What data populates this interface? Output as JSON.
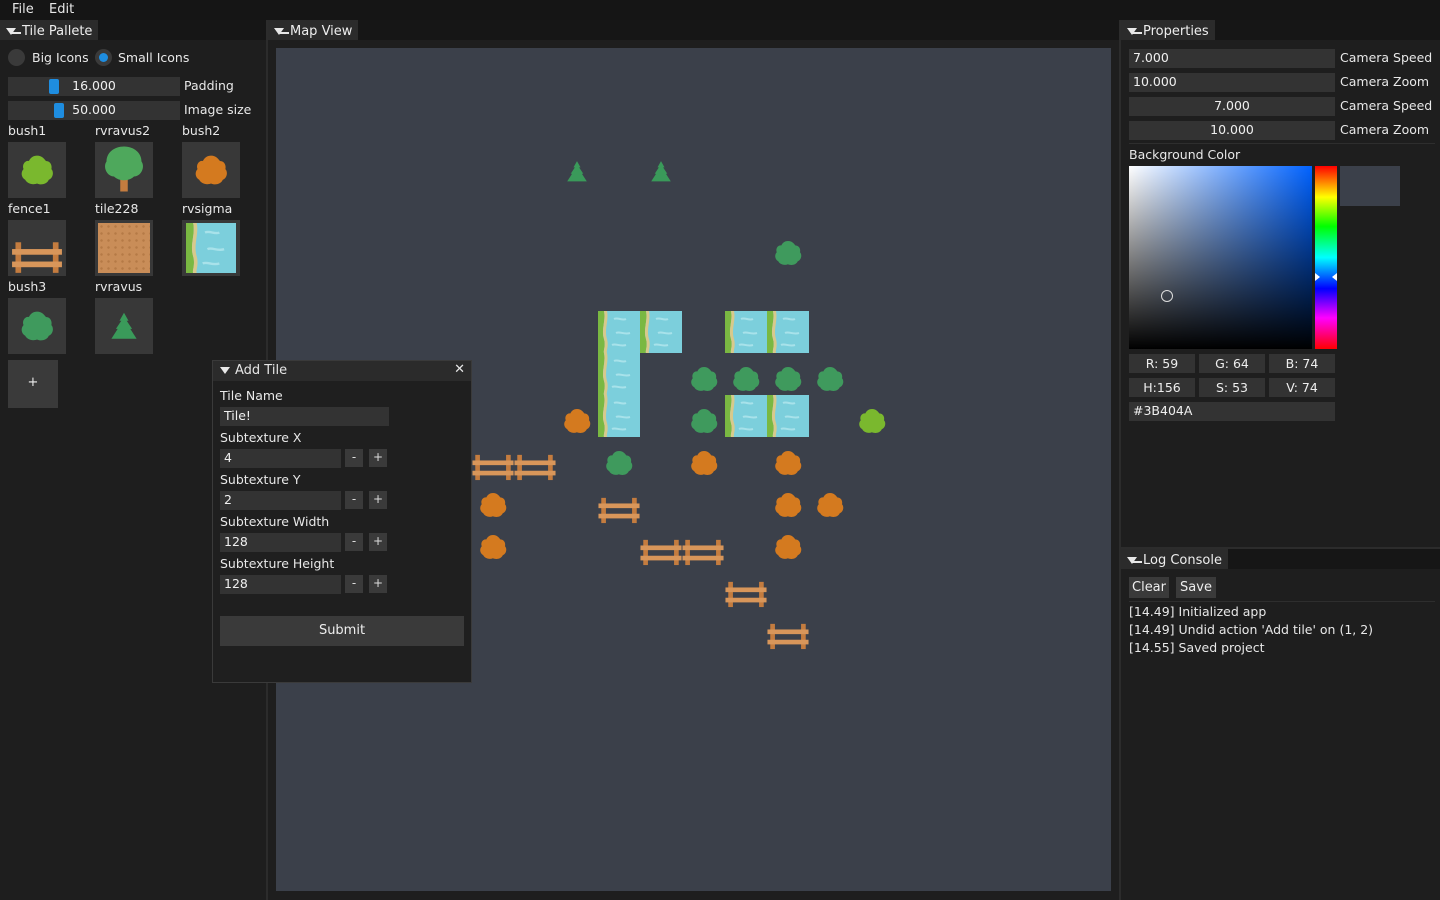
{
  "menu": {
    "file": "File",
    "edit": "Edit"
  },
  "palette": {
    "title": "Tile Pallete",
    "radio_big": "Big Icons",
    "radio_small": "Small Icons",
    "padding_value": "16.000",
    "padding_label": "Padding",
    "image_size_value": "50.000",
    "image_size_label": "Image size",
    "tiles": [
      {
        "name": "bush1",
        "icon": "bush-lime-icon"
      },
      {
        "name": "rvravus2",
        "icon": "tree-icon"
      },
      {
        "name": "bush2",
        "icon": "bush-orange-icon"
      },
      {
        "name": "fence1",
        "icon": "fence-icon"
      },
      {
        "name": "tile228",
        "icon": "dirt-tile-icon"
      },
      {
        "name": "rvsigma",
        "icon": "river-tile-icon"
      },
      {
        "name": "bush3",
        "icon": "bush-green-icon"
      },
      {
        "name": "rvravus",
        "icon": "pine-icon"
      }
    ],
    "add_label": "+"
  },
  "map": {
    "title": "Map View",
    "background": "#3b404a"
  },
  "add_tile": {
    "title": "Add Tile",
    "close_glyph": "✕",
    "tile_name_label": "Tile Name",
    "tile_name_value": "Tile!",
    "sub_x_label": "Subtexture X",
    "sub_x_value": "4",
    "sub_y_label": "Subtexture Y",
    "sub_y_value": "2",
    "sub_w_label": "Subtexture Width",
    "sub_w_value": "128",
    "sub_h_label": "Subtexture Height",
    "sub_h_value": "128",
    "minus": "-",
    "plus": "+",
    "submit": "Submit"
  },
  "properties": {
    "title": "Properties",
    "rows": [
      {
        "value": "7.000",
        "label": "Camera Speed"
      },
      {
        "value": "10.000",
        "label": "Camera Zoom"
      },
      {
        "value": "7.000",
        "label": "Camera Speed"
      },
      {
        "value": "10.000",
        "label": "Camera Zoom"
      }
    ],
    "bg_color_label": "Background Color",
    "r": "R: 59",
    "g": "G: 64",
    "b": "B: 74",
    "h": "H:156",
    "s": "S: 53",
    "v": "V: 74",
    "hex": "#3B404A",
    "color": "#3b404a"
  },
  "log": {
    "title": "Log Console",
    "clear": "Clear",
    "save": "Save",
    "lines": [
      "[14.49] Initialized app",
      "[14.49] Undid action 'Add tile' on (1, 2)",
      "[14.55] Saved project"
    ]
  },
  "colors": {
    "accent": "#1e8de0",
    "panel": "#1e1e1e",
    "field": "#333333"
  }
}
